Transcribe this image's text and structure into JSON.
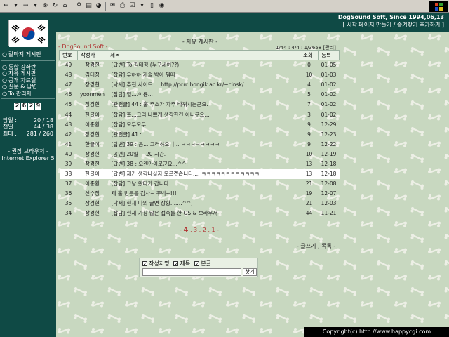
{
  "toolbar": {
    "icons": [
      "back-arrow",
      "forward-arrow",
      "stop",
      "refresh",
      "home",
      "search",
      "favorites",
      "print",
      "history",
      "mail",
      "edit",
      "discuss",
      "window",
      "winflag"
    ]
  },
  "header": {
    "site_title": "DogSound Soft, Since 1994,06,13",
    "site_links": "[ 시작 페이지 만들기 / 즐겨찾기 추가하기 ]"
  },
  "sidebar": {
    "menu_top": "갈마지 게시판",
    "menu_items": [
      "통합 강좌란",
      "자유 게시판",
      "공개 자료실",
      "질문 & 답변",
      "To.관리자"
    ],
    "counter": [
      "2",
      "6",
      "2",
      "9"
    ],
    "stats": [
      {
        "label": "당일 :",
        "value": "20 / 18"
      },
      {
        "label": "전일 :",
        "value": "44 / 38"
      },
      {
        "label": "최대 :",
        "value": "281 / 260"
      }
    ],
    "browser_note_1": "- 권장 브라우저 -",
    "browser_note_2": "Internet Explorer 5"
  },
  "board": {
    "title": "- 자유 게시판 -",
    "logo": "- DogSound Soft -",
    "info": "1/44 : 4/4 : 1/3658 [관리]",
    "columns": [
      "번호",
      "작성자",
      "제목",
      "조회",
      "등록"
    ],
    "rows": [
      [
        "49",
        "장경현",
        "[답변] To.김태정 (누구세여??)",
        "0",
        "01-05"
      ],
      [
        "48",
        "김태정",
        "[잡담] 우하하 개술 박아 뭐따",
        "10",
        "01-03"
      ],
      [
        "47",
        "장경현",
        "[낙서] 추천 사이트.... http://pcrc.hongik.ac.kr/~cinsk/",
        "4",
        "01-02"
      ],
      [
        "46",
        "yoonmen",
        "[잡담] 헐....이룡...",
        "5",
        "01-02"
      ],
      [
        "45",
        "장경현",
        "[관련글] 44 : 홈 주소가 자주 바뀌시는군요.",
        "7",
        "01-02"
      ],
      [
        "44",
        "한글이",
        "[잡담] 홈...그리 나쁘게 생각한건 아니구요...",
        "3",
        "01-02"
      ],
      [
        "43",
        "이종환",
        "[잡담] 모두모두....",
        "9",
        "12-29"
      ],
      [
        "42",
        "장경현",
        "[관련글] 41 : ...........",
        "9",
        "12-23"
      ],
      [
        "41",
        "한글이",
        "[답변] 39 : 음... 그러하오니... ㅋㅋㅋㅋㅋㅋㅋㅋ",
        "9",
        "12-22"
      ],
      [
        "40",
        "장경현",
        "[공연] 20일 + 20 시간.",
        "10",
        "12-19"
      ],
      [
        "39",
        "장경현",
        "[답변] 38 : 오랜만이로군요...^^;",
        "13",
        "12-18"
      ],
      [
        "38",
        "한글이",
        "[답변] 제가 생각나실지 모르겠습니다.... ㅋㅋㅋㅋㅋㅋㅋㅋㅋㅋㅋㅋ",
        "13",
        "12-18"
      ],
      [
        "37",
        "이종환",
        "[잡담] 그냥 왔다가 갑니다...",
        "21",
        "12-08"
      ],
      [
        "36",
        "신수정",
        "제 홈 방문을 감사~ 꾸벅~!!!",
        "19",
        "12-07"
      ],
      [
        "35",
        "장경현",
        "[낙서] 현재 나의 글연 상황.......^^;",
        "21",
        "12-03"
      ],
      [
        "34",
        "장경현",
        "[잡담] 현재 가장 많은 접속률 한 OS & 브라우저",
        "44",
        "11-21"
      ]
    ],
    "highlight_row": 11
  },
  "pager": {
    "current": "4",
    "others": " , 3 , 2 , 1"
  },
  "write_links": "- 글쓰기 , 목록 -",
  "search": {
    "opt_writer": "작성자명",
    "opt_subject": "제목",
    "opt_body": "본글",
    "input_value": "",
    "button": "찾기"
  },
  "footer": {
    "copyright": "Copyright(c) http://www.happycgi.com"
  },
  "colors": {
    "sidebar": "#0f4a45",
    "board_bg": "#c8d8c0",
    "accent": "#b03030"
  }
}
